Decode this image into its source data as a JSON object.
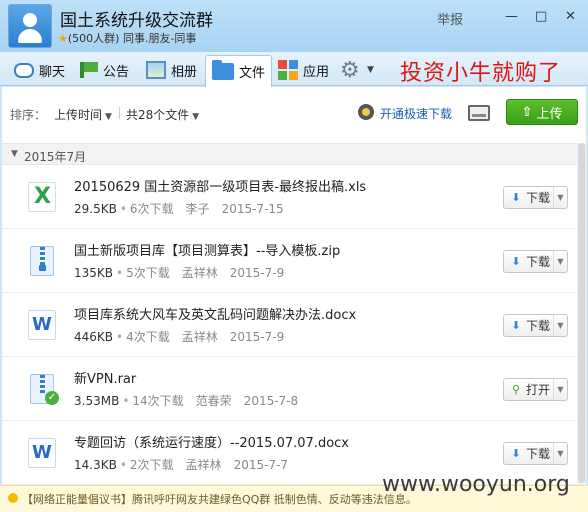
{
  "window": {
    "title": "国土系统升级交流群",
    "member_info": "(500人群) 同事.朋友-同事",
    "report_label": "举报",
    "controls": [
      "—",
      "□",
      "✕"
    ]
  },
  "toolbar": {
    "tabs": [
      {
        "label": "聊天",
        "icon": "chat-icon"
      },
      {
        "label": "公告",
        "icon": "notice-icon"
      },
      {
        "label": "相册",
        "icon": "album-icon"
      },
      {
        "label": "文件",
        "icon": "folder-icon",
        "active": true
      },
      {
        "label": "应用",
        "icon": "apps-icon"
      }
    ],
    "settings_icon": "gear-icon"
  },
  "overlay_text": "投资小牛就购了",
  "sortbar": {
    "sort_label": "排序：",
    "sort_value": "上传时间",
    "count_value": "共28个文件",
    "fast_download_link": "开通极速下载",
    "upload_button": "上传"
  },
  "group": {
    "label": "2015年7月"
  },
  "files": [
    {
      "name": "20150629 国土资源部一级项目表-最终报出稿.xls",
      "type": "xls",
      "size": "29.5KB",
      "downloads": "6次下载",
      "uploader": "李子",
      "date": "2015-7-15",
      "action": "下载"
    },
    {
      "name": "国土新版项目库【项目测算表】--导入模板.zip",
      "type": "zip",
      "size": "135KB",
      "downloads": "5次下载",
      "uploader": "孟祥林",
      "date": "2015-7-9",
      "action": "下载"
    },
    {
      "name": "项目库系统大风车及英文乱码问题解决办法.docx",
      "type": "doc",
      "size": "446KB",
      "downloads": "4次下载",
      "uploader": "孟祥林",
      "date": "2015-7-9",
      "action": "下载"
    },
    {
      "name": "新VPN.rar",
      "type": "rar",
      "size": "3.53MB",
      "downloads": "14次下载",
      "uploader": "范春荣",
      "date": "2015-7-8",
      "action": "打开"
    },
    {
      "name": "专题回访（系统运行速度）--2015.07.07.docx",
      "type": "doc",
      "size": "14.3KB",
      "downloads": "2次下载",
      "uploader": "孟祥林",
      "date": "2015-7-7",
      "action": "下载"
    }
  ],
  "footer": {
    "notice": "【网络正能量倡议书】腾讯呼吁网友共建绿色QQ群 抵制色情、反动等违法信息。"
  },
  "watermark": "www.wooyun.org"
}
